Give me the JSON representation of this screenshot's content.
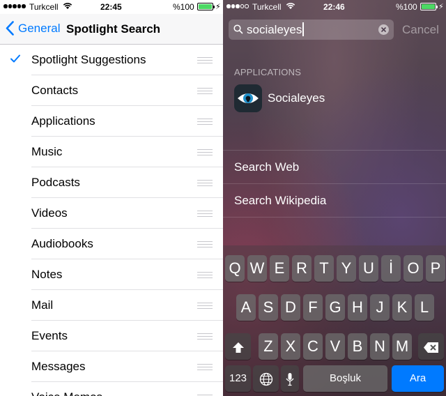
{
  "left_status": {
    "carrier": "Turkcell",
    "time": "22:45",
    "battery": "%100"
  },
  "right_status": {
    "carrier": "Turkcell",
    "time": "22:46",
    "battery": "%100"
  },
  "settings": {
    "back_label": "General",
    "title": "Spotlight Search",
    "items": [
      {
        "label": "Spotlight Suggestions",
        "checked": true
      },
      {
        "label": "Contacts",
        "checked": false
      },
      {
        "label": "Applications",
        "checked": false
      },
      {
        "label": "Music",
        "checked": false
      },
      {
        "label": "Podcasts",
        "checked": false
      },
      {
        "label": "Videos",
        "checked": false
      },
      {
        "label": "Audiobooks",
        "checked": false
      },
      {
        "label": "Notes",
        "checked": false
      },
      {
        "label": "Mail",
        "checked": false
      },
      {
        "label": "Events",
        "checked": false
      },
      {
        "label": "Messages",
        "checked": false
      },
      {
        "label": "Voice Memos",
        "checked": false
      }
    ]
  },
  "spotlight": {
    "query": "socialeyes",
    "cancel_label": "Cancel",
    "section_header": "APPLICATIONS",
    "app_result": "Socialeyes",
    "search_web": "Search Web",
    "search_wikipedia": "Search Wikipedia"
  },
  "keyboard": {
    "row1": [
      "Q",
      "W",
      "E",
      "R",
      "T",
      "Y",
      "U",
      "İ",
      "O",
      "P"
    ],
    "row2": [
      "A",
      "S",
      "D",
      "F",
      "G",
      "H",
      "J",
      "K",
      "L"
    ],
    "row3": [
      "Z",
      "X",
      "C",
      "V",
      "B",
      "N",
      "M"
    ],
    "numbers_label": "123",
    "space_label": "Boşluk",
    "go_label": "Ara"
  },
  "colors": {
    "accent": "#007aff",
    "battery": "#4cd964"
  }
}
